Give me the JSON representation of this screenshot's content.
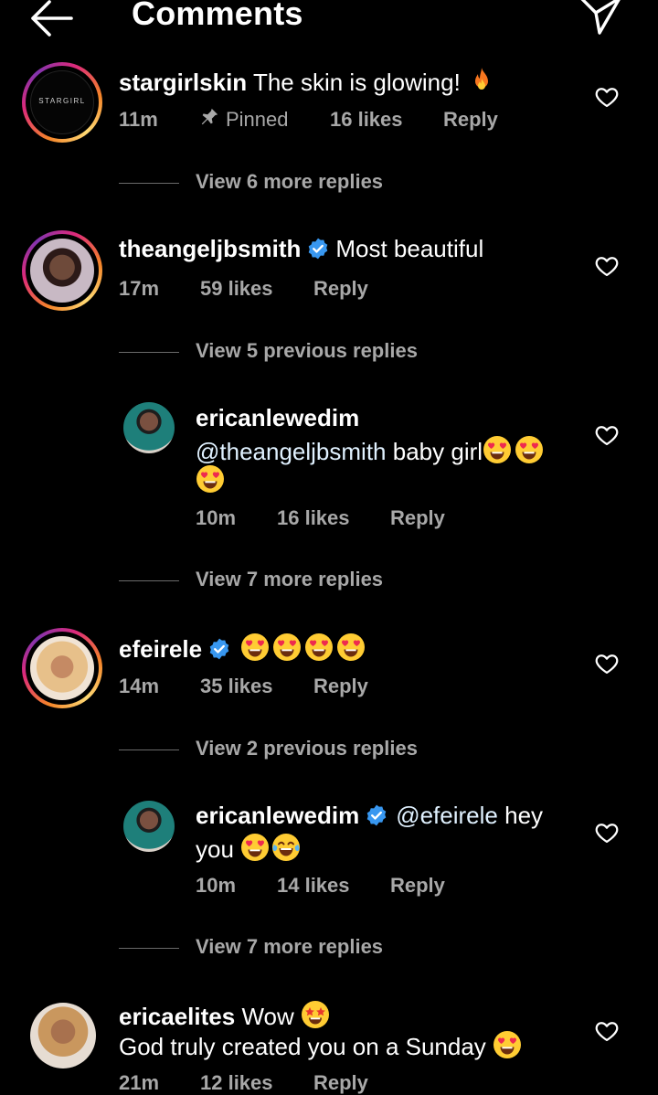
{
  "header": {
    "title": "Comments"
  },
  "comments": [
    {
      "username": "stargirlskin",
      "text": "The skin is glowing!",
      "avatar_text": "STARGIRL",
      "time": "11m",
      "pinned_label": "Pinned",
      "likes": "16 likes",
      "reply_label": "Reply",
      "view_replies": "View 6 more replies"
    },
    {
      "username": "theangeljbsmith",
      "text": "Most beautiful",
      "time": "17m",
      "likes": "59 likes",
      "reply_label": "Reply",
      "view_replies": "View 5 previous replies",
      "reply": {
        "username": "ericanlewedim",
        "mention": "@theangeljbsmith",
        "text": "baby girl",
        "time": "10m",
        "likes": "16 likes",
        "reply_label": "Reply"
      },
      "view_more": "View 7 more replies"
    },
    {
      "username": "efeirele",
      "time": "14m",
      "likes": "35 likes",
      "reply_label": "Reply",
      "view_replies": "View 2 previous replies",
      "reply": {
        "username": "ericanlewedim",
        "mention": "@efeirele",
        "text": "hey",
        "text_line2": "you",
        "time": "10m",
        "likes": "14 likes",
        "reply_label": "Reply"
      },
      "view_more": "View 7 more replies"
    },
    {
      "username": "ericaelites",
      "text": "Wow",
      "text_line2": "God truly created you on a Sunday",
      "time": "21m",
      "likes": "12 likes",
      "reply_label": "Reply"
    }
  ],
  "colors": {
    "background": "#000000",
    "text": "#ffffff",
    "secondary_text": "#a8a8a8",
    "verified_badge": "#3897f0"
  },
  "icons": {
    "back": "arrow-left-icon",
    "share": "paper-plane-icon",
    "like": "heart-outline-icon",
    "pin": "pin-icon",
    "verified": "verified-badge-icon",
    "fire": "fire-emoji",
    "heart_eyes": "heart-eyes-emoji",
    "tears_of_joy": "face-with-tears-of-joy-emoji",
    "star_struck": "star-struck-emoji"
  }
}
